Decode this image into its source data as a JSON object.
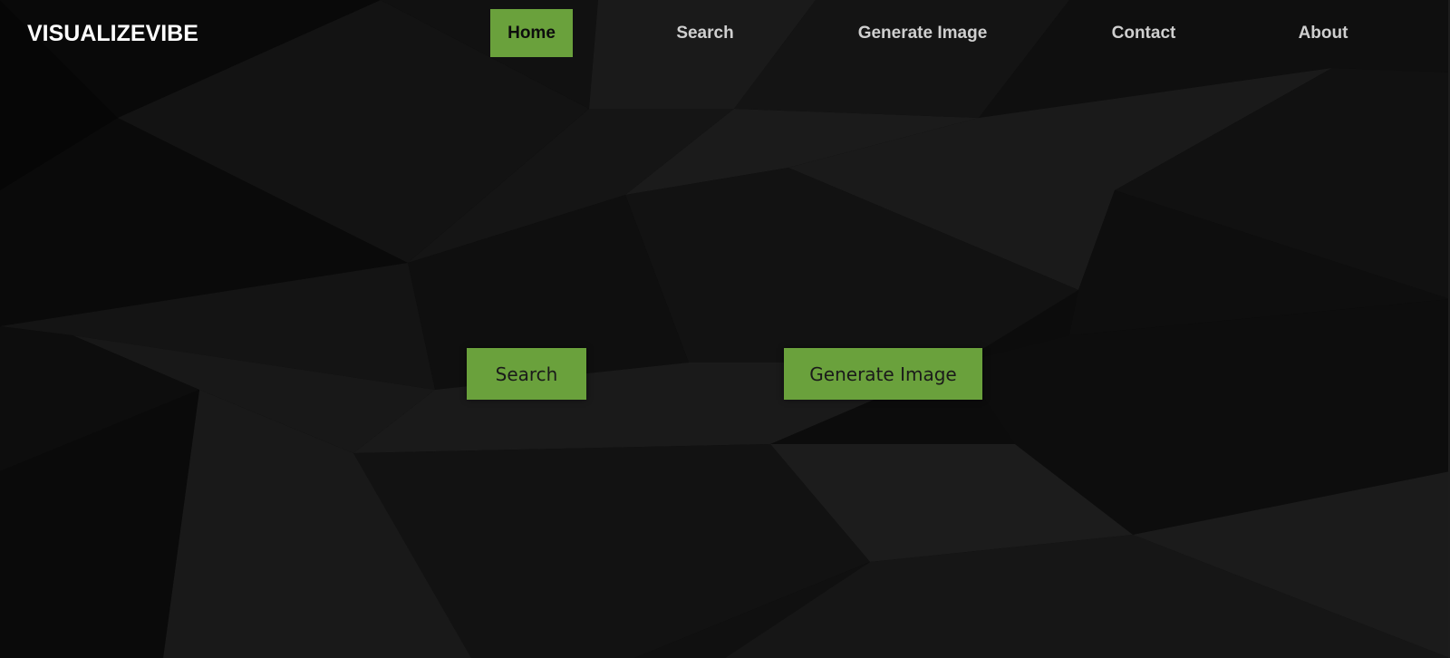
{
  "brand": {
    "name": "VISUALIZEVIBE"
  },
  "nav": {
    "items": [
      {
        "label": "Home",
        "active": true
      },
      {
        "label": "Search",
        "active": false
      },
      {
        "label": "Generate Image",
        "active": false
      },
      {
        "label": "Contact",
        "active": false
      },
      {
        "label": "About",
        "active": false
      }
    ]
  },
  "hero": {
    "search_button": "Search",
    "generate_button": "Generate Image"
  },
  "theme": {
    "accent": "#6aa13c",
    "background": "#0b0b0b",
    "nav_text": "#cfcfcf",
    "active_text": "#0d0d0d"
  }
}
